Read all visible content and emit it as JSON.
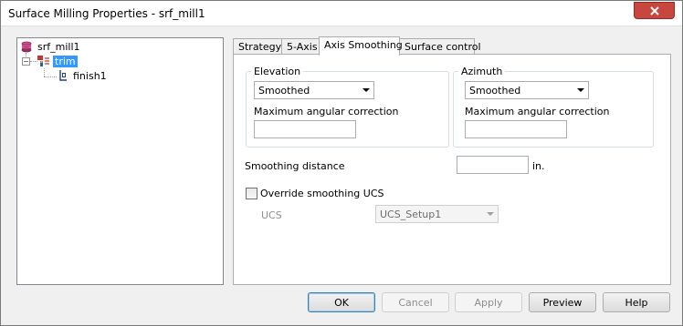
{
  "window": {
    "title": "Surface Milling Properties - srf_mill1"
  },
  "tree": {
    "root_label": "srf_mill1",
    "child_label": "trim",
    "grandchild_label": "finish1",
    "expander_symbol": "−"
  },
  "tabs": [
    {
      "label": "Strategy",
      "active": false
    },
    {
      "label": "5-Axis",
      "active": false
    },
    {
      "label": "Axis Smoothing",
      "active": true
    },
    {
      "label": "Surface control",
      "active": false
    }
  ],
  "elevation": {
    "title": "Elevation",
    "mode_value": "Smoothed",
    "max_correction_label": "Maximum angular correction",
    "max_correction_value": ""
  },
  "azimuth": {
    "title": "Azimuth",
    "mode_value": "Smoothed",
    "max_correction_label": "Maximum angular correction",
    "max_correction_value": ""
  },
  "smoothing": {
    "distance_label": "Smoothing distance",
    "distance_value": "",
    "unit": "in.",
    "override_label": "Override smoothing UCS",
    "override_checked": false,
    "ucs_label": "UCS",
    "ucs_value": "UCS_Setup1"
  },
  "buttons": {
    "ok": "OK",
    "cancel": "Cancel",
    "apply": "Apply",
    "preview": "Preview",
    "help": "Help"
  },
  "colors": {
    "selection": "#3399ff",
    "close_button": "#c7473f"
  }
}
